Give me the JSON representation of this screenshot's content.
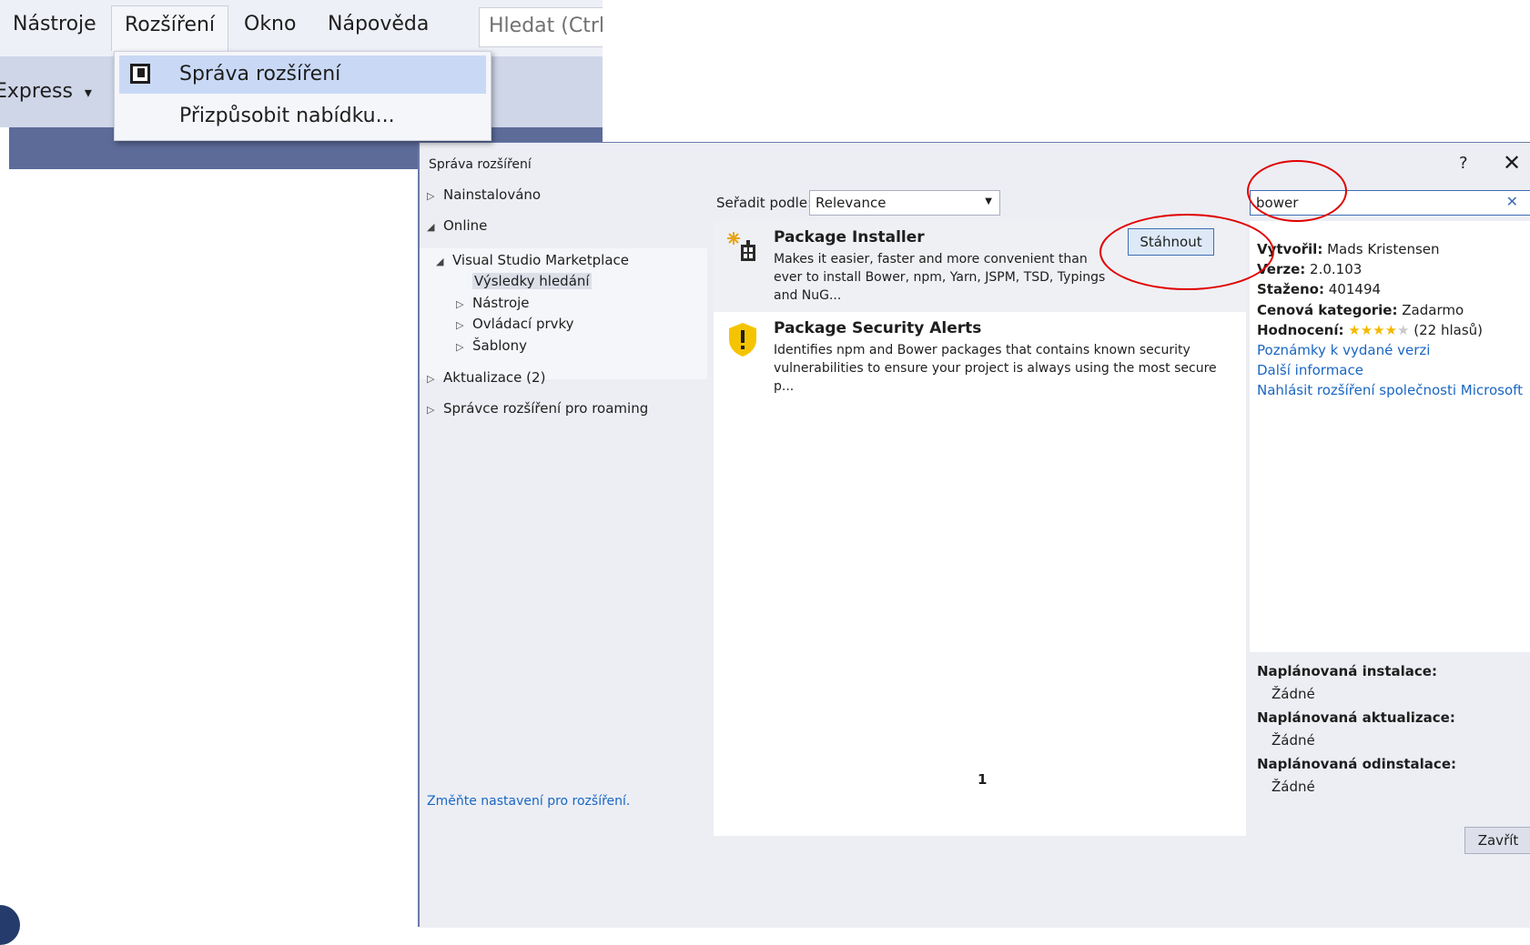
{
  "menubar": {
    "items": [
      "Nástroje",
      "Rozšíření",
      "Okno",
      "Nápověda"
    ],
    "active_item": "Rozšíření",
    "search_placeholder": "Hledat (Ctrl-"
  },
  "toolbar": {
    "config_label": "Express",
    "config_caret": "▾"
  },
  "dropdown": {
    "items": [
      {
        "label": "Správa rozšíření",
        "icon": "extensions-icon",
        "highlighted": true
      },
      {
        "label": "Přizpůsobit nabídku...",
        "icon": "",
        "highlighted": false
      }
    ]
  },
  "dialog": {
    "title": "Správa rozšíření",
    "help_glyph": "?",
    "close_glyph": "✕",
    "tree": {
      "installed": "Nainstalováno",
      "online": "Online",
      "marketplace": "Visual Studio Marketplace",
      "search_results": "Výsledky hledání",
      "tools": "Nástroje",
      "controls": "Ovládací prvky",
      "templates": "Šablony",
      "updates": "Aktualizace (2)",
      "roaming": "Správce rozšíření pro roaming"
    },
    "sort": {
      "label": "Seřadit podle:",
      "value": "Relevance"
    },
    "search": {
      "value": "bower",
      "clear_glyph": "✕"
    },
    "results": [
      {
        "title": "Package Installer",
        "description": "Makes it easier, faster and more convenient than ever to install Bower, npm, Yarn, JSPM, TSD, Typings and NuG...",
        "icon": "package-installer-icon",
        "button": "Stáhnout"
      },
      {
        "title": "Package Security Alerts",
        "description": "Identifies npm and Bower packages that contains known security vulnerabilities to ensure your project is always using the most secure p...",
        "icon": "security-alert-icon"
      }
    ],
    "page_number": "1",
    "details": {
      "author_label": "Vytvořil:",
      "author": "Mads Kristensen",
      "version_label": "Verze:",
      "version": "2.0.103",
      "downloads_label": "Staženo:",
      "downloads": "401494",
      "price_label": "Cenová kategorie:",
      "price": "Zadarmo",
      "rating_label": "Hodnocení:",
      "rating_stars": 4,
      "rating_max": 5,
      "rating_votes": "(22 hlasů)",
      "release_notes": "Poznámky k vydané verzi",
      "more_info": "Další informace",
      "report": "Nahlásit rozšíření společnosti Microsoft"
    },
    "scheduled": {
      "install_label": "Naplánovaná instalace:",
      "install_value": "Žádné",
      "update_label": "Naplánovaná aktualizace:",
      "update_value": "Žádné",
      "uninstall_label": "Naplánovaná odinstalace:",
      "uninstall_value": "Žádné"
    },
    "settings_link": "Změňte nastavení pro rozšíření.",
    "close_button": "Zavřít"
  },
  "colors": {
    "annotation_red": "#e00000",
    "link_blue": "#1a66c2",
    "accent_blue": "#3e6db5",
    "star_gold": "#f3b900"
  }
}
